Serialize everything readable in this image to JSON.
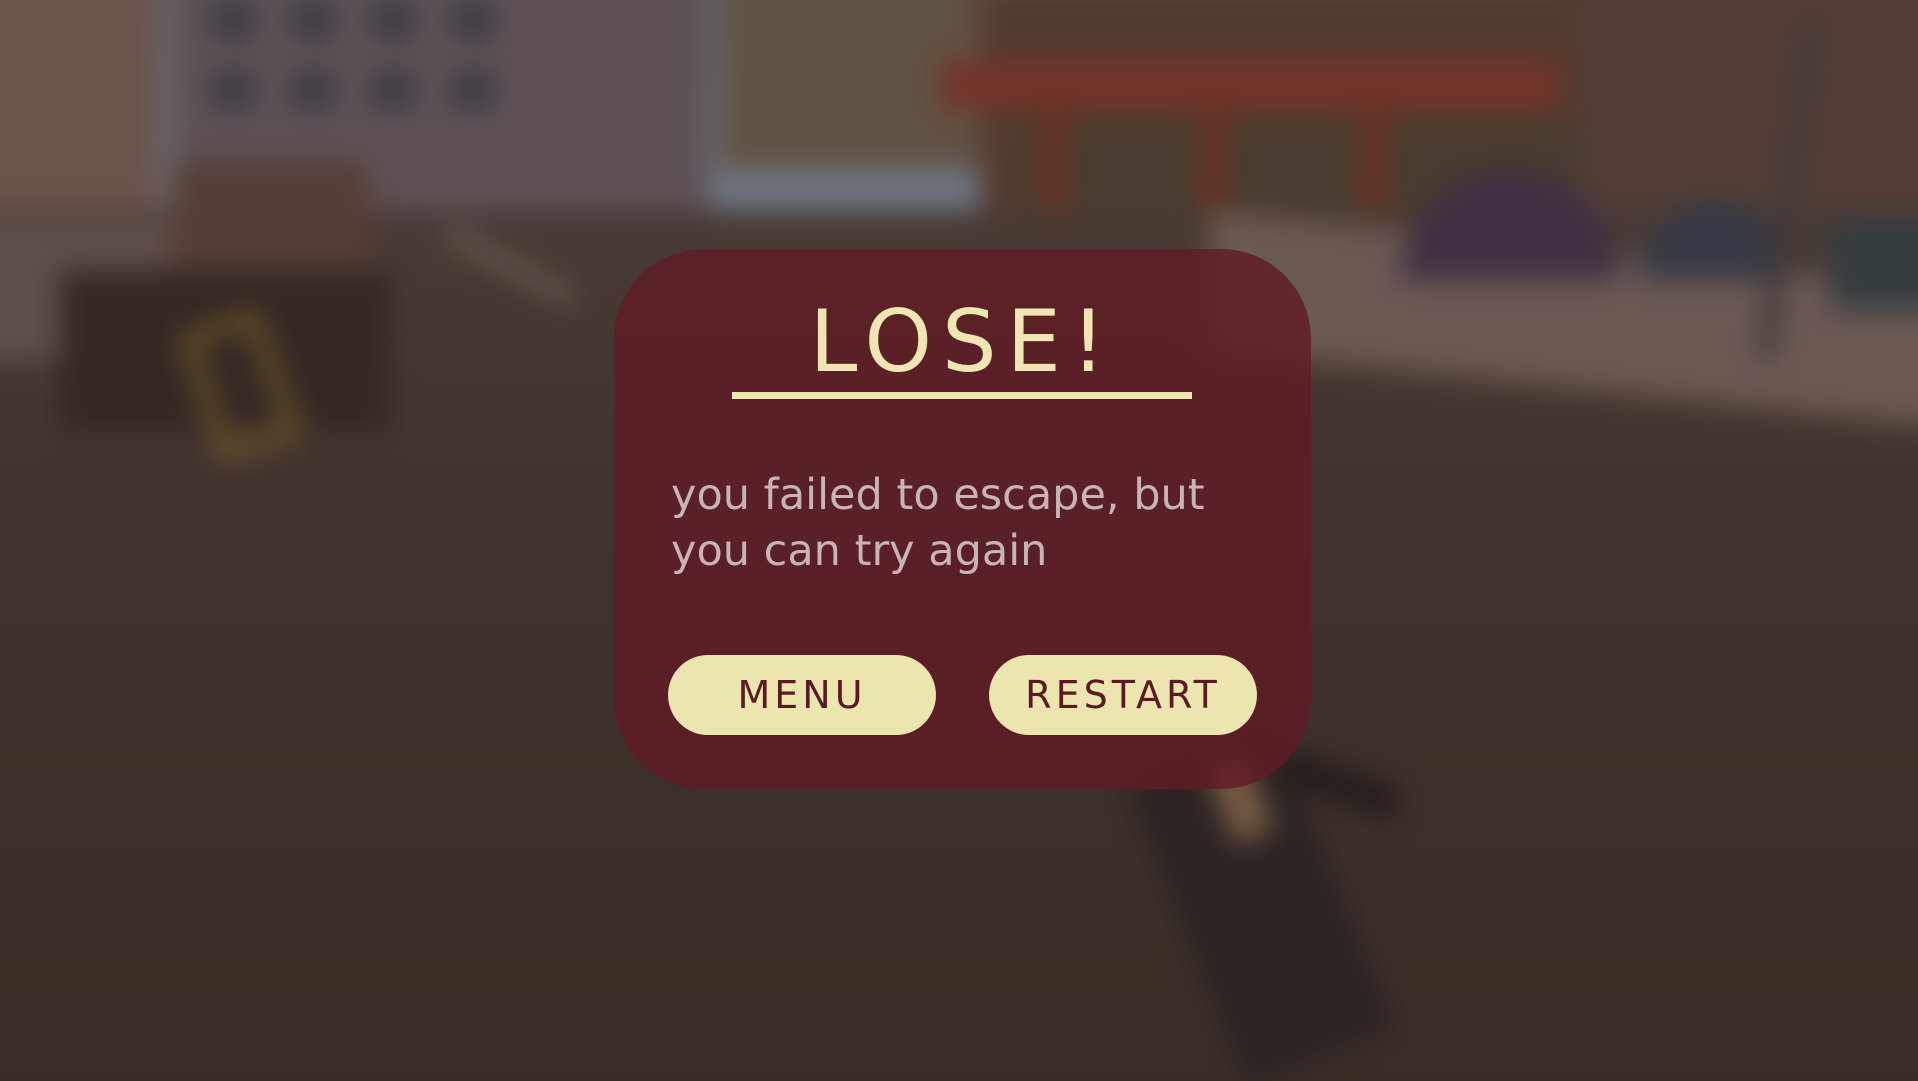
{
  "dialog": {
    "title": "LOSE!",
    "message": "you failed to escape, but\nyou can try again",
    "buttons": {
      "menu_label": "MENU",
      "restart_label": "RESTART"
    }
  },
  "colors": {
    "panel_background": "#601c26",
    "title_text": "#f0e6b4",
    "message_text": "#c8b4b4",
    "button_background": "#ede5b0",
    "button_text": "#5a1a22"
  }
}
